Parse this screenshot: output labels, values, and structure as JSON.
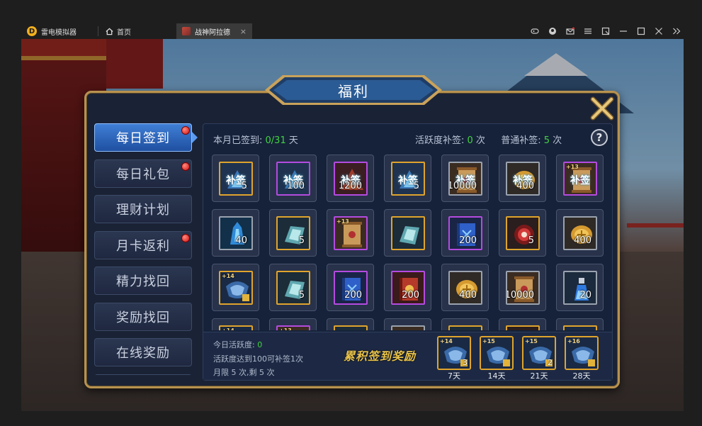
{
  "app": {
    "brand": "雷电模拟器",
    "home_tab": "首页",
    "game_tab": "战神阿拉德",
    "tab_close": "×"
  },
  "panel": {
    "title": "福利"
  },
  "menu": {
    "items": [
      {
        "label": "每日签到",
        "active": true,
        "dot": true
      },
      {
        "label": "每日礼包",
        "active": false,
        "dot": true
      },
      {
        "label": "理财计划",
        "active": false,
        "dot": false
      },
      {
        "label": "月卡返利",
        "active": false,
        "dot": true
      },
      {
        "label": "精力找回",
        "active": false,
        "dot": false
      },
      {
        "label": "奖励找回",
        "active": false,
        "dot": false
      },
      {
        "label": "在线奖励",
        "active": false,
        "dot": false
      }
    ]
  },
  "header": {
    "signed_label": "本月已签到: ",
    "signed_value": "0/31",
    "signed_unit": " 天",
    "active_supp_label": "活跃度补签: ",
    "active_supp_value": "0",
    "active_supp_unit": " 次",
    "normal_supp_label": "普通补签: ",
    "normal_supp_value": "5",
    "normal_supp_unit": " 次",
    "help": "?"
  },
  "grid": {
    "rows": [
      [
        {
          "kind": "bq",
          "text": "补签",
          "qty": "5",
          "frame": "gold",
          "art": "blue"
        },
        {
          "kind": "bq",
          "text": "补签",
          "qty": "100",
          "frame": "purple",
          "art": "blue"
        },
        {
          "kind": "bq",
          "text": "补签",
          "qty": "1200",
          "frame": "purple",
          "art": "red"
        },
        {
          "kind": "bq",
          "text": "补签",
          "qty": "5",
          "frame": "gold",
          "art": "blue"
        },
        {
          "kind": "bq",
          "text": "补签",
          "qty": "10000",
          "frame": "gray",
          "art": "scroll"
        },
        {
          "kind": "bq",
          "text": "补签",
          "qty": "400",
          "frame": "gray",
          "art": "coin"
        },
        {
          "kind": "bq",
          "text": "补签",
          "qty": "",
          "frame": "purple",
          "art": "scroll",
          "plus": "+13"
        }
      ],
      [
        {
          "kind": "item",
          "qty": "40",
          "frame": "gray",
          "art": "crystal"
        },
        {
          "kind": "item",
          "qty": "5",
          "frame": "gold",
          "art": "stone"
        },
        {
          "kind": "item",
          "qty": "",
          "frame": "purple",
          "art": "scroll",
          "plus": "+13"
        },
        {
          "kind": "item",
          "qty": "",
          "frame": "gold",
          "art": "stone"
        },
        {
          "kind": "item",
          "qty": "200",
          "frame": "purple",
          "art": "book"
        },
        {
          "kind": "item",
          "qty": "5",
          "frame": "gold",
          "art": "orb"
        },
        {
          "kind": "item",
          "qty": "400",
          "frame": "gray",
          "art": "coin"
        }
      ],
      [
        {
          "kind": "item",
          "qty": "",
          "frame": "gold",
          "art": "armor",
          "plus": "+14"
        },
        {
          "kind": "item",
          "qty": "5",
          "frame": "gold",
          "art": "stone"
        },
        {
          "kind": "item",
          "qty": "200",
          "frame": "purple",
          "art": "book"
        },
        {
          "kind": "item",
          "qty": "200",
          "frame": "purple",
          "art": "redbook"
        },
        {
          "kind": "item",
          "qty": "400",
          "frame": "gray",
          "art": "coin"
        },
        {
          "kind": "item",
          "qty": "10000",
          "frame": "gray",
          "art": "scroll"
        },
        {
          "kind": "item",
          "qty": "20",
          "frame": "gray",
          "art": "potion"
        }
      ],
      [
        {
          "kind": "item",
          "qty": "",
          "frame": "gold",
          "art": "armor",
          "plus": "+14"
        },
        {
          "kind": "item",
          "qty": "",
          "frame": "purple",
          "art": "scroll",
          "plus": "+13"
        },
        {
          "kind": "item",
          "qty": "",
          "frame": "gold",
          "art": "stone"
        },
        {
          "kind": "item",
          "qty": "",
          "frame": "gray",
          "art": "scroll"
        },
        {
          "kind": "item",
          "qty": "",
          "frame": "gold",
          "art": "stone"
        },
        {
          "kind": "item",
          "qty": "",
          "frame": "gold",
          "art": "orb"
        },
        {
          "kind": "item",
          "qty": "",
          "frame": "gold",
          "art": "armor"
        }
      ]
    ]
  },
  "bottom": {
    "today_label": "今日活跃度: ",
    "today_value": "0",
    "rule": "活跃度达到100可补签1次",
    "limit": "月限 5 次,剩 5 次",
    "reward_title": "累积签到奖励",
    "rewards": [
      {
        "plus": "+14",
        "qty": "3",
        "day": "7天"
      },
      {
        "plus": "+15",
        "qty": "",
        "day": "14天"
      },
      {
        "plus": "+15",
        "qty": "2",
        "day": "21天"
      },
      {
        "plus": "+16",
        "qty": "",
        "day": "28天"
      }
    ]
  },
  "colors": {
    "accent_green": "#42d442",
    "gold_frame": "#e0a42c",
    "purple_frame": "#b44be0",
    "gray_frame": "#9aa2ae",
    "active_menu": "#3f7fd6"
  }
}
